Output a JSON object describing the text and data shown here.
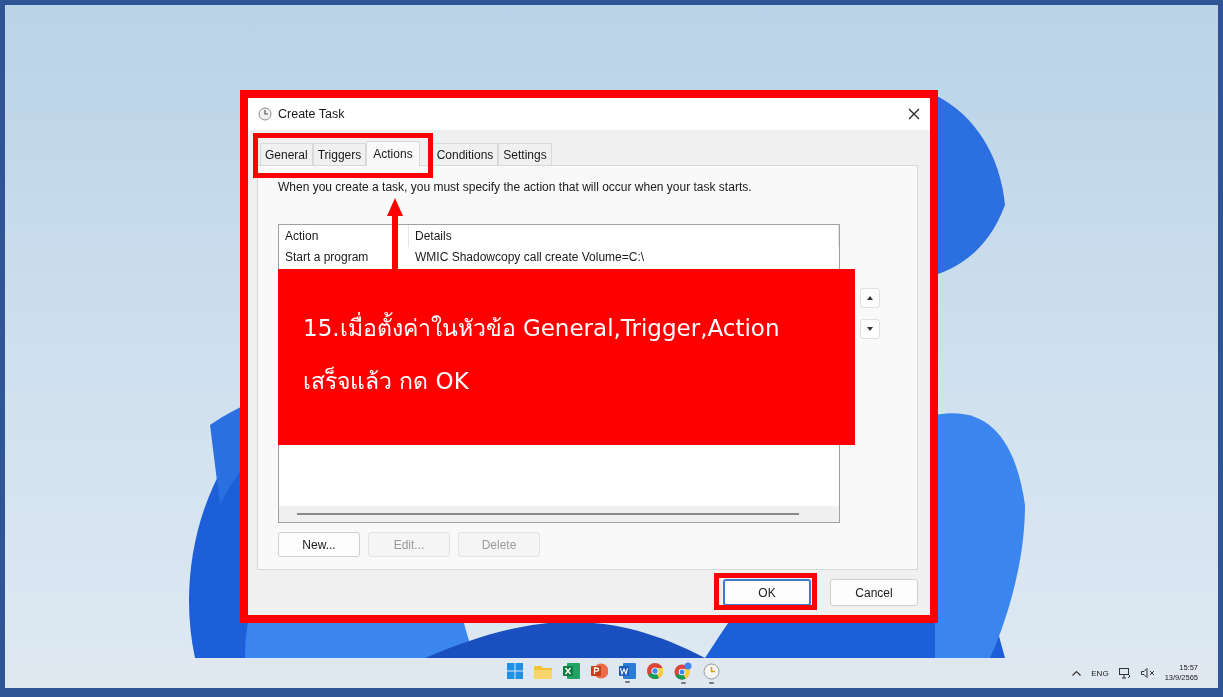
{
  "window": {
    "title": "Create Task"
  },
  "tabs": [
    {
      "label": "General",
      "selected": false
    },
    {
      "label": "Triggers",
      "selected": false
    },
    {
      "label": "Actions",
      "selected": true
    },
    {
      "label": "Conditions",
      "selected": false
    },
    {
      "label": "Settings",
      "selected": false
    }
  ],
  "description": "When you create a task, you must specify the action that will occur when your task starts.",
  "table": {
    "columns": [
      "Action",
      "Details"
    ],
    "rows": [
      {
        "action": "Start a program",
        "details": "WMIC Shadowcopy call create Volume=C:\\"
      }
    ]
  },
  "action_buttons": [
    {
      "label": "New...",
      "disabled": false
    },
    {
      "label": "Edit...",
      "disabled": true
    },
    {
      "label": "Delete",
      "disabled": true
    }
  ],
  "footer_buttons": [
    {
      "label": "OK",
      "default": true
    },
    {
      "label": "Cancel",
      "default": false
    }
  ],
  "annotation": {
    "lines": [
      "15.เมื่อตั้งค่าในหัวข้อ General,Trigger,Action",
      "เสร็จแล้ว กด OK"
    ]
  },
  "taskbar": {
    "apps": [
      {
        "kind": "start",
        "running": false
      },
      {
        "kind": "folder",
        "running": false
      },
      {
        "kind": "spreadsheet",
        "running": false
      },
      {
        "kind": "presentation",
        "running": false
      },
      {
        "kind": "document",
        "running": true
      },
      {
        "kind": "browser",
        "running": false
      },
      {
        "kind": "browser-dev",
        "running": true
      },
      {
        "kind": "clock",
        "running": true
      }
    ],
    "language": "ENG",
    "time": "15:57",
    "date": "13/9/2565"
  }
}
